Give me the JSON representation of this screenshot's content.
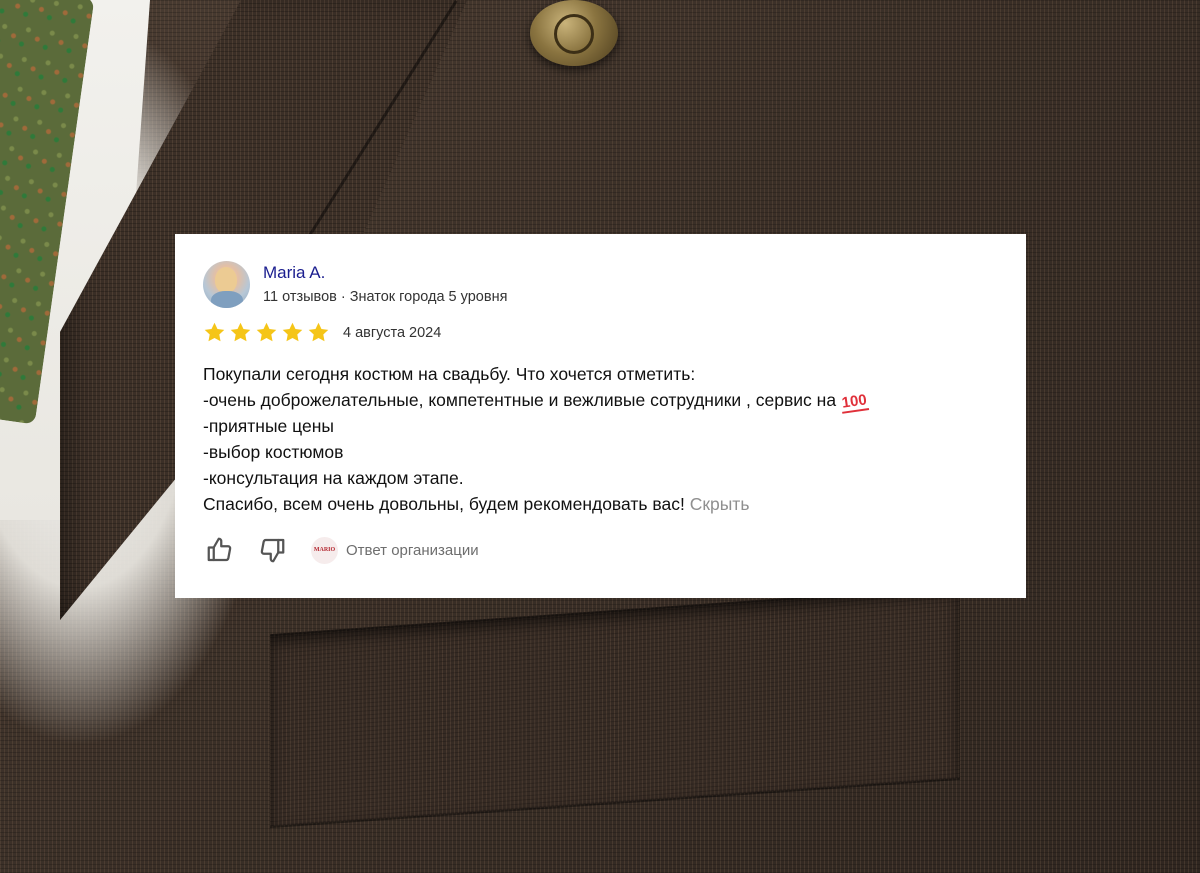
{
  "review": {
    "author_name": "Maria A.",
    "author_meta": "11 отзывов · Знаток города 5 уровня",
    "rating": 5,
    "rating_max": 5,
    "date": "4 августа 2024",
    "lines": [
      "Покупали сегодня костюм на свадьбу. Что хочется отметить:",
      "-очень доброжелательные, компетентные и вежливые сотрудники , сервис на",
      "-приятные цены",
      "-выбор костюмов",
      "-консультация на каждом этапе.",
      "Спасибо, всем очень довольны, будем рекомендовать вас!"
    ],
    "emoji": "100",
    "hide_label": "Скрыть",
    "org_logo_text": "MARIO",
    "org_reply_label": "Ответ организации"
  },
  "icons": {
    "like": "thumbs-up-icon",
    "dislike": "thumbs-down-icon",
    "star": "star-icon"
  },
  "colors": {
    "author_name": "#1b1e8f",
    "star": "#f5c518",
    "hide_link": "#8f8f8f",
    "emoji": "#e0303a"
  }
}
